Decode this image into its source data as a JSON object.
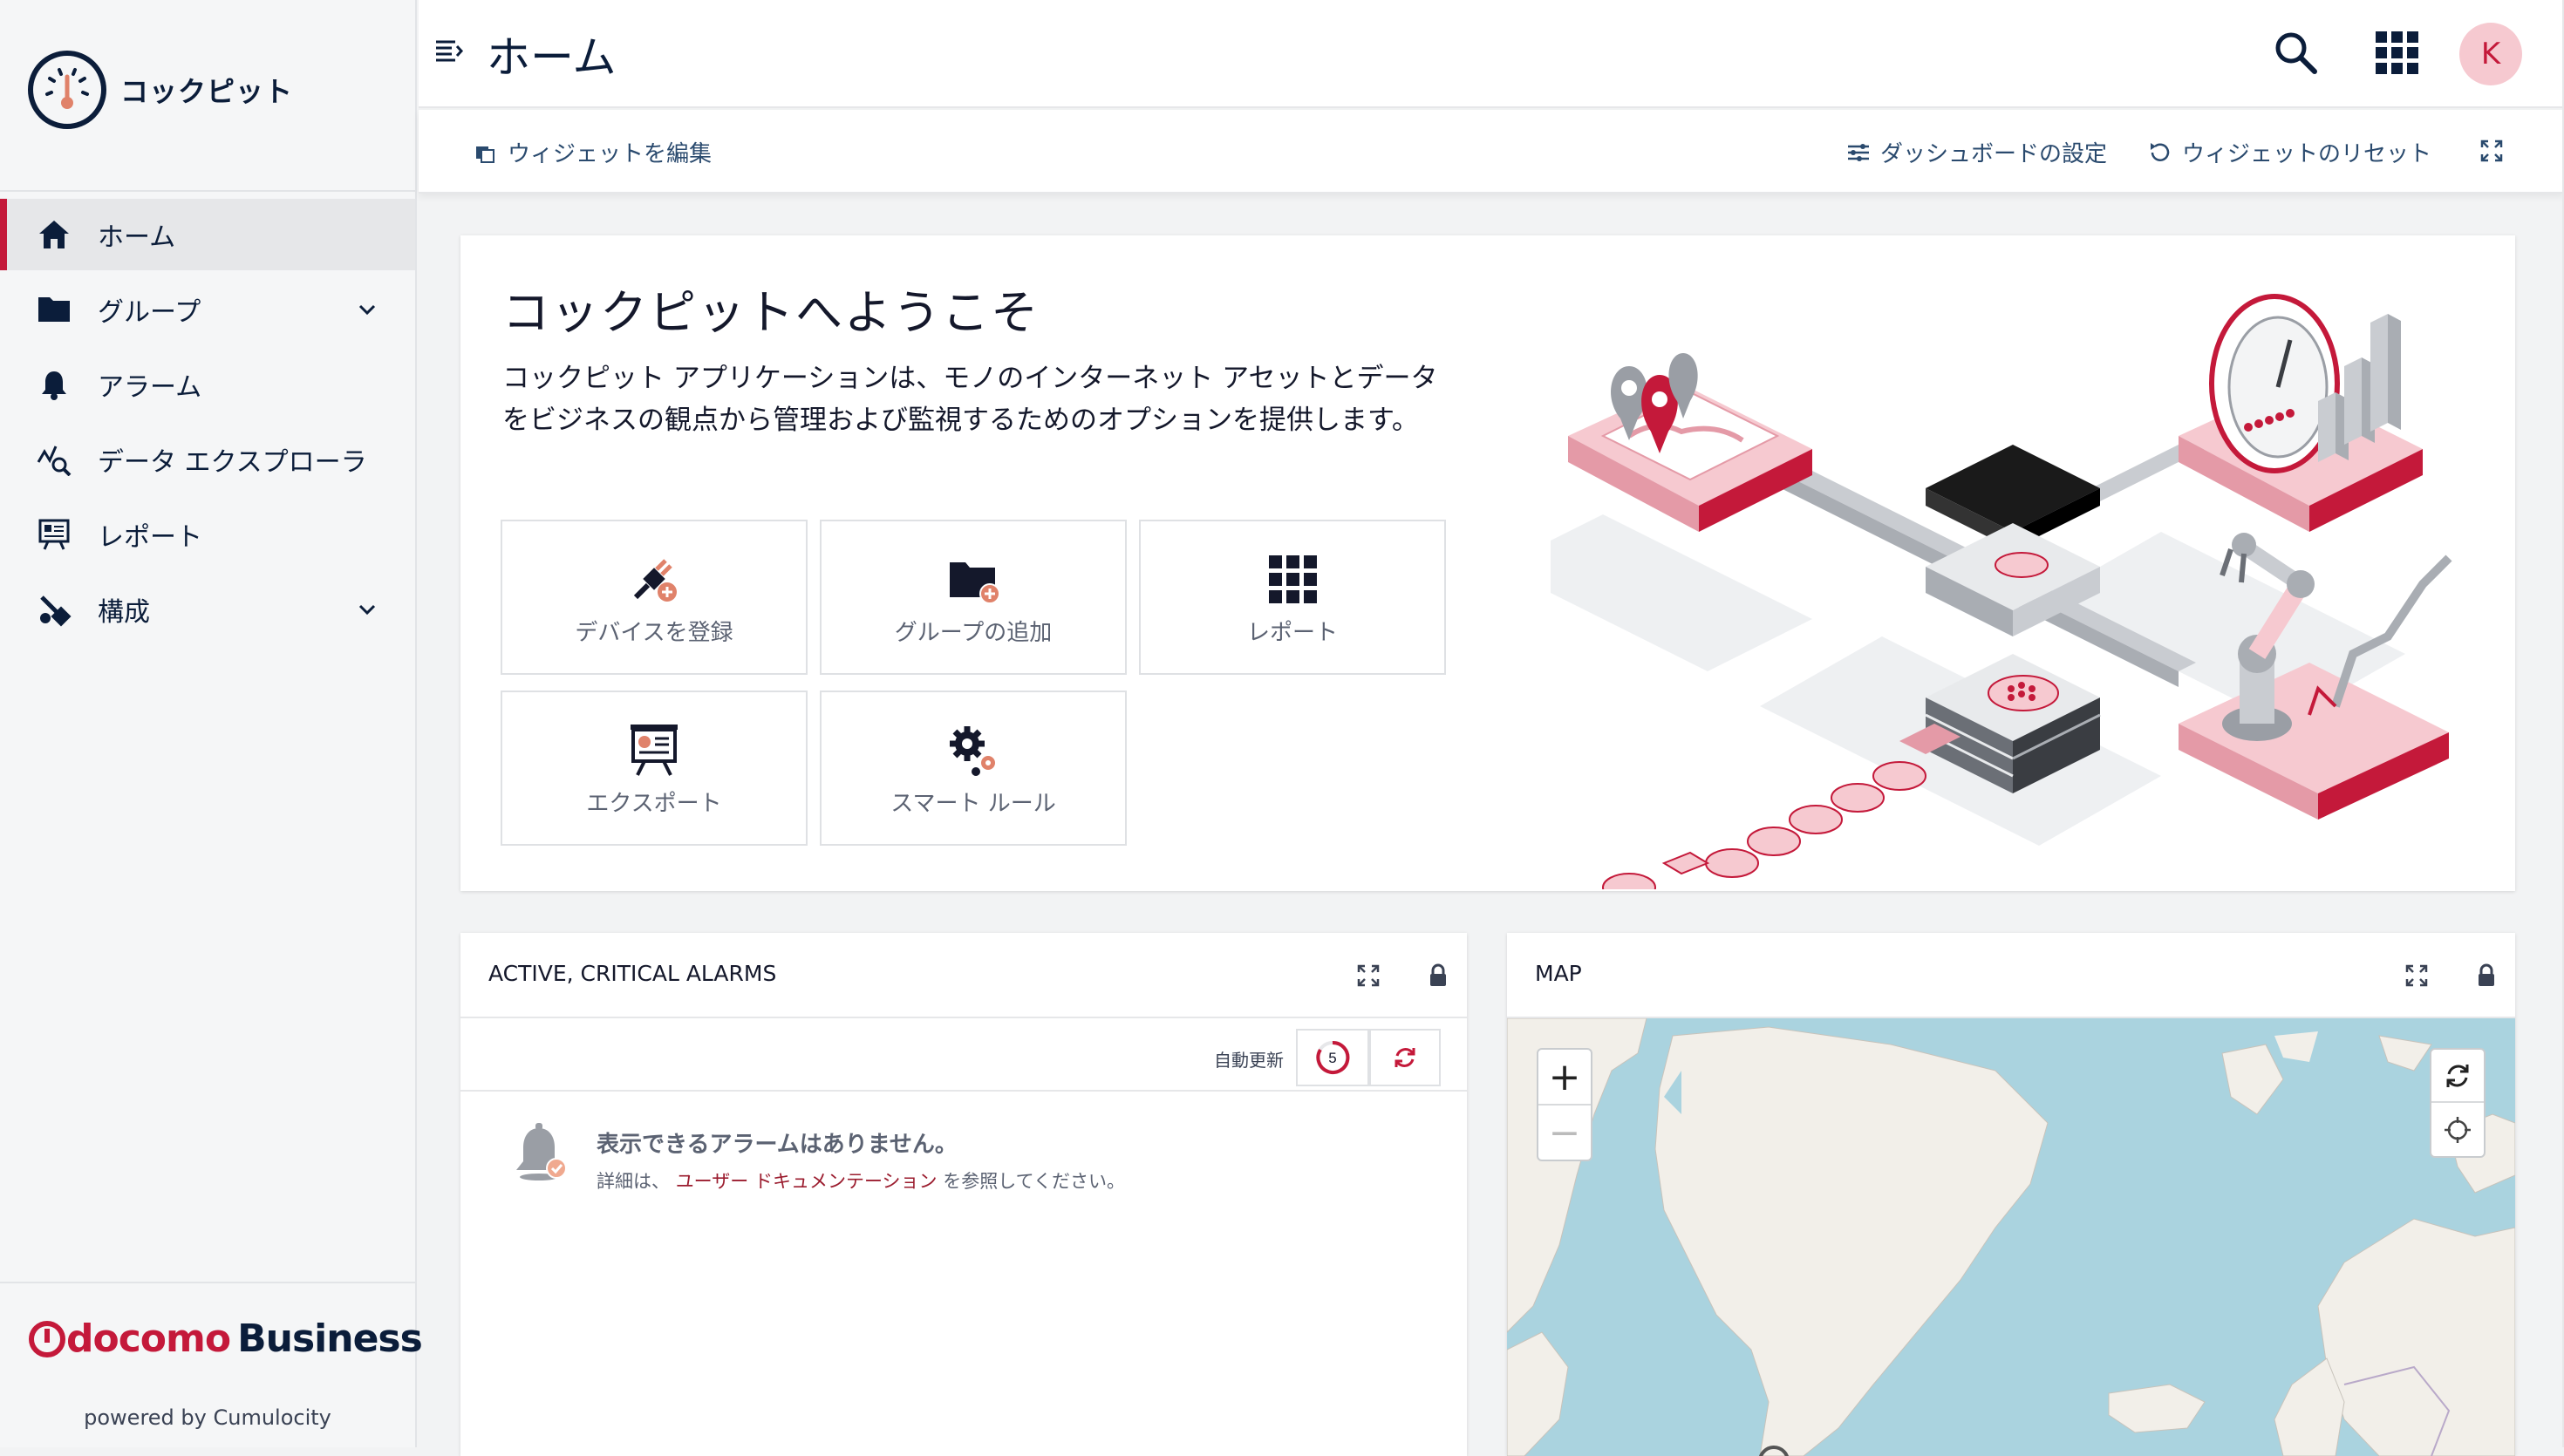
{
  "app": {
    "name": "コックピット"
  },
  "sidebar": {
    "items": [
      {
        "label": "ホーム",
        "icon": "home-icon",
        "active": true
      },
      {
        "label": "グループ",
        "icon": "folder-icon",
        "expandable": true
      },
      {
        "label": "アラーム",
        "icon": "bell-icon"
      },
      {
        "label": "データ エクスプローラ",
        "icon": "data-explorer-icon"
      },
      {
        "label": "レポート",
        "icon": "report-icon"
      },
      {
        "label": "構成",
        "icon": "configuration-icon",
        "expandable": true
      }
    ],
    "footer": {
      "brand_docomo": "docomo",
      "brand_business": "Business",
      "powered_by": "powered by Cumulocity"
    }
  },
  "header": {
    "title": "ホーム",
    "avatar_initial": "K"
  },
  "actions": {
    "edit_widgets": "ウィジェットを編集",
    "dashboard_settings": "ダッシュボードの設定",
    "reset_widgets": "ウィジェットのリセット"
  },
  "welcome": {
    "title": "コックピットへようこそ",
    "text": "コックピット アプリケーションは、モノのインターネット アセットとデータ をビジネスの観点から管理および監視するためのオプションを提供します。",
    "tiles": [
      {
        "label": "デバイスを登録",
        "icon": "register-device-icon"
      },
      {
        "label": "グループの追加",
        "icon": "add-group-icon"
      },
      {
        "label": "レポート",
        "icon": "grid-report-icon"
      },
      {
        "label": "エクスポート",
        "icon": "export-icon"
      },
      {
        "label": "スマート ルール",
        "icon": "smart-rules-icon"
      }
    ]
  },
  "alarms_widget": {
    "title": "ACTIVE, CRITICAL ALARMS",
    "auto_refresh_label": "自動更新",
    "countdown": "5",
    "empty_title": "表示できるアラームはありません。",
    "empty_prefix": "詳細は、",
    "empty_link": "ユーザー ドキュメンテーション",
    "empty_suffix": "を参照してください。"
  },
  "map_widget": {
    "title": "MAP",
    "zoom_in": "+",
    "zoom_out": "−"
  },
  "colors": {
    "accent": "#c4193a",
    "navy": "#0b1d3a",
    "map_water": "#aad3df",
    "map_land": "#f2efe9"
  }
}
